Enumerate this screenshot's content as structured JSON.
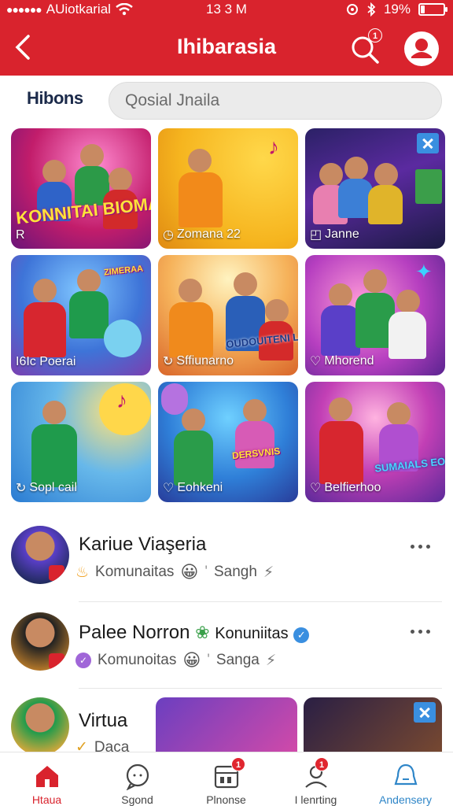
{
  "status_bar": {
    "carrier": "AUiotkarial",
    "time": "13 3 M",
    "battery_text": "19%",
    "battery_level": 0.19
  },
  "header": {
    "title": "Ihibarasia",
    "search_badge": "1",
    "accent_color": "#d9232d"
  },
  "logo_text": "Hibons",
  "search": {
    "placeholder": "Qosial Jnaila"
  },
  "grid": {
    "tiles": [
      {
        "label": "",
        "banner": "KONNITAI BIOMA",
        "icon": "",
        "has_close": false
      },
      {
        "label": "Zomana 22",
        "banner": "",
        "icon": "clock-icon",
        "has_close": false
      },
      {
        "label": "Janne",
        "banner": "",
        "icon": "tag-icon",
        "has_close": true
      },
      {
        "label": "I6Ic Poerai",
        "banner": "",
        "icon": "",
        "has_close": false
      },
      {
        "label": "Sffiunarno",
        "banner": "OUDOUITENI LAVVEERH",
        "icon": "refresh-icon",
        "has_close": false
      },
      {
        "label": "Mhorend",
        "banner": "",
        "icon": "heart-icon",
        "has_close": false
      },
      {
        "label": "Sopl cail",
        "banner": "",
        "icon": "refresh-icon",
        "has_close": false
      },
      {
        "label": "Eohkeni",
        "banner": "",
        "icon": "heart-icon",
        "has_close": false
      },
      {
        "label": "Belfierhoo",
        "banner": "SUMAIALS EOIUEEA",
        "icon": "heart-icon",
        "has_close": false
      }
    ],
    "first_tile_tag": "R"
  },
  "feed": [
    {
      "name": "Kariue Viaşeria",
      "community": "Komunaitas",
      "emoji": "😀",
      "sub": "Sangh",
      "extra": ""
    },
    {
      "name": "Palee Norron",
      "community": "Komunoitas",
      "emoji": "😀",
      "sub": "Sanga",
      "extra": "Konuniitas"
    },
    {
      "name": "Virtua",
      "community": "Daca",
      "emoji": "",
      "sub": "",
      "extra": ""
    }
  ],
  "bottom_nav": [
    {
      "label": "Htaua",
      "icon": "home-icon",
      "active": true,
      "badge": ""
    },
    {
      "label": "Sgond",
      "icon": "chat-search-icon",
      "active": false,
      "badge": ""
    },
    {
      "label": "Plnonse",
      "icon": "calendar-icon",
      "active": false,
      "badge": "1"
    },
    {
      "label": "I lenrting",
      "icon": "person-icon",
      "active": false,
      "badge": "1"
    },
    {
      "label": "Andensery",
      "icon": "bell-icon",
      "active": false,
      "badge": ""
    }
  ]
}
